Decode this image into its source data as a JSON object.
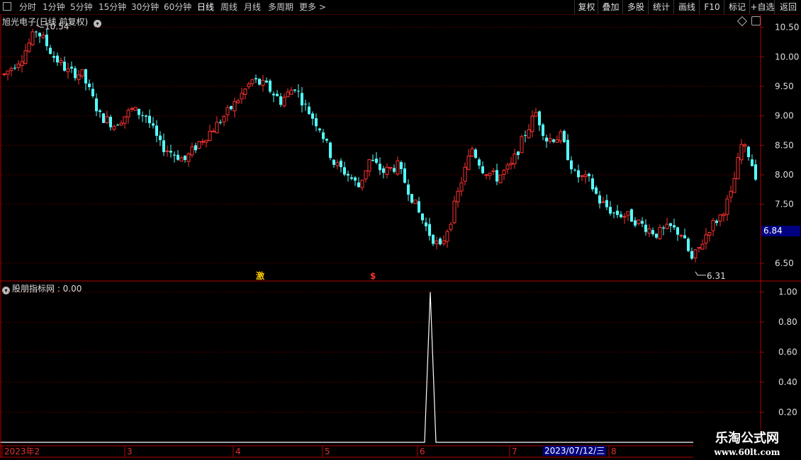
{
  "toolbar": {
    "left_items": [
      "分时",
      "1分钟",
      "5分钟",
      "15分钟",
      "30分钟",
      "60分钟",
      "日线",
      "周线",
      "月线",
      "多周期",
      "更多 >"
    ],
    "active_item": "日线",
    "right_items": [
      "复权",
      "叠加",
      "多股",
      "统计",
      "画线",
      "F10",
      "标记",
      "+自选",
      "返回"
    ]
  },
  "main_chart": {
    "title": "旭光电子(日线 前复权)",
    "high_label": "10.54",
    "low_label": "6.31",
    "current_price_tag": "6.84",
    "y_ticks": [
      "10.50",
      "10.00",
      "9.50",
      "9.00",
      "8.50",
      "8.00",
      "7.50",
      "6.50"
    ],
    "marker_1": "激",
    "marker_2": "$"
  },
  "sub_chart": {
    "title": "股朋指标网 : 0.00",
    "y_ticks": [
      "1.00",
      "0.80",
      "0.60",
      "0.40",
      "0.20"
    ]
  },
  "x_axis": {
    "labels": [
      "2023年2",
      "3",
      "4",
      "5",
      "6",
      "7",
      "8"
    ],
    "selected_date": "2023/07/12/三"
  },
  "watermark": {
    "line1": "乐淘公式网",
    "line2": "www.60lt.com"
  },
  "colors": {
    "up": "#ff3232",
    "down": "#54ffff",
    "grid": "#8b0000",
    "axis": "#b00000",
    "background": "#000000",
    "tag": "#000080"
  },
  "chart_data": {
    "type": "candlestick",
    "price_range": [
      6.2,
      10.7
    ],
    "indicator_range": [
      0,
      1.05
    ],
    "indicator_name": "股朋指标网",
    "indicator_peak": {
      "value": 1.0,
      "month": "6"
    }
  }
}
